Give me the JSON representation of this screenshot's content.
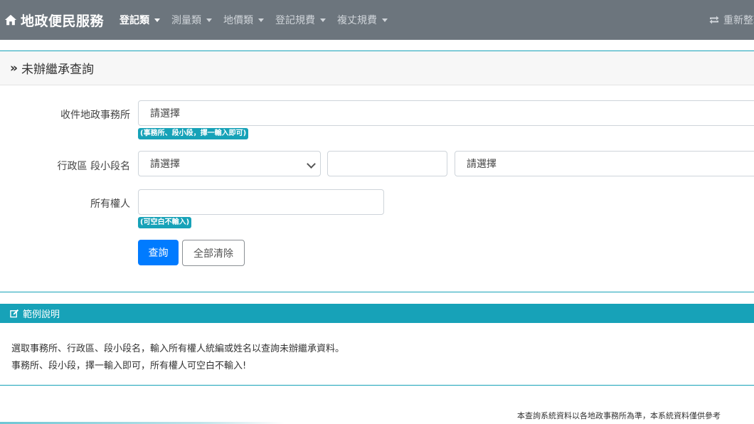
{
  "navbar": {
    "brand": "地政便民服務",
    "items": [
      {
        "label": "登記類",
        "active": true
      },
      {
        "label": "測量類"
      },
      {
        "label": "地價類"
      },
      {
        "label": "登記規費"
      },
      {
        "label": "複丈規費"
      }
    ],
    "reload_label": "重新整理"
  },
  "page": {
    "title": "未辦繼承查詢"
  },
  "form": {
    "office_label": "收件地政事務所",
    "office_value": "請選擇",
    "office_hint": "(事務所、段小段，擇一輸入即可)",
    "district_label": "行政區 段小段名",
    "district_value": "請選擇",
    "section_code_value": "",
    "section_name_value": "請選擇",
    "owner_label": "所有權人",
    "owner_value": "",
    "owner_hint": "(可空白不輸入)",
    "search_button": "查詢",
    "clear_button": "全部清除"
  },
  "example": {
    "title": "範例說明",
    "line1": "選取事務所、行政區、段小段名，輸入所有權人統編或姓名以查詢未辦繼承資料。",
    "line2": "事務所、段小段，擇一輸入即可，所有權人可空白不輸入!"
  },
  "footer": {
    "note": "本查詢系統資料以各地政事務所為準，本系統資料僅供參考"
  },
  "colors": {
    "navbar": "#6c757d",
    "accent": "#17a2b8",
    "primary": "#007bff"
  }
}
